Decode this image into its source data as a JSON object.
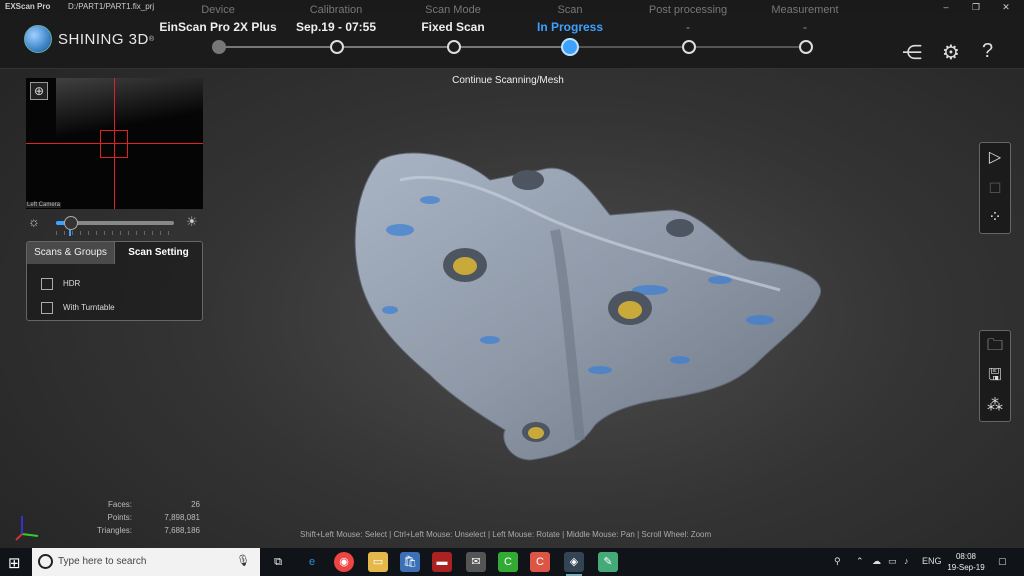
{
  "titlebar": {
    "app": "EXScan Pro",
    "path": "D:/PART1/PART1.fix_prj"
  },
  "brand": {
    "name": "SHINING 3D"
  },
  "steps": [
    {
      "label": "Device",
      "value": "EinScan Pro 2X Plus"
    },
    {
      "label": "Calibration",
      "value": "Sep.19 - 07:55"
    },
    {
      "label": "Scan Mode",
      "value": "Fixed Scan"
    },
    {
      "label": "Scan",
      "value": "In Progress"
    },
    {
      "label": "Post processing",
      "value": "-"
    },
    {
      "label": "Measurement",
      "value": "-"
    }
  ],
  "continue_label": "Continue Scanning/Mesh",
  "camera": {
    "label": "Left Camera"
  },
  "panel": {
    "tab_groups": "Scans & Groups",
    "tab_setting": "Scan Setting",
    "hdr": "HDR",
    "turntable": "With Turntable"
  },
  "stats": {
    "faces_label": "Faces:",
    "faces": "26",
    "points_label": "Points:",
    "points": "7,898,081",
    "triangles_label": "Triangles:",
    "triangles": "7,688,186"
  },
  "hint": "Shift+Left Mouse: Select | Ctrl+Left Mouse: Unselect | Left Mouse: Rotate | Middle Mouse: Pan | Scroll Wheel: Zoom",
  "taskbar": {
    "search_placeholder": "Type here to search",
    "lang": "ENG",
    "time": "08:08",
    "date": "19-Sep-19"
  },
  "colors": {
    "accent": "#3da2ff",
    "header_bg": "#1b1b1b",
    "crosshair": "#dd2222"
  }
}
